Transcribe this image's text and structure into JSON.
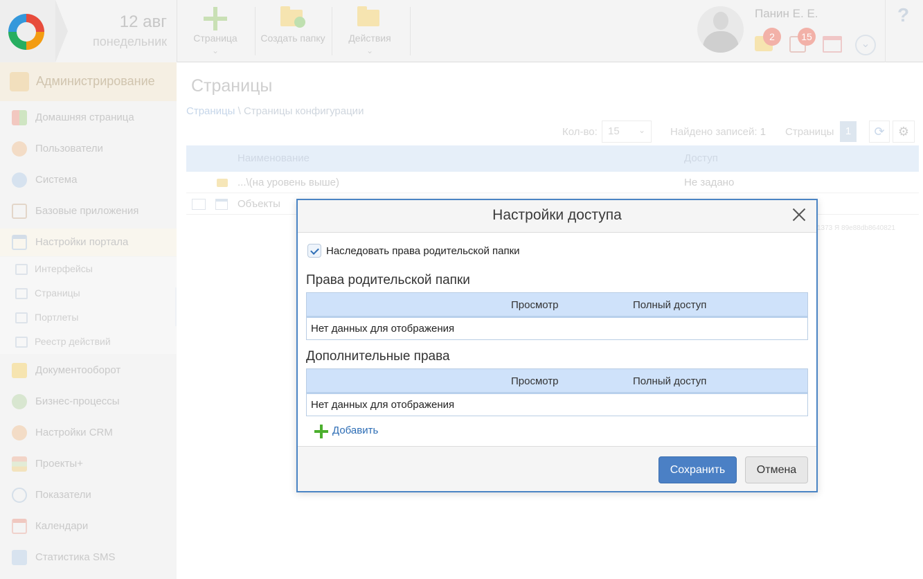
{
  "topbar": {
    "date_day": "12 авг",
    "date_weekday": "понедельник",
    "buttons": [
      {
        "label": "Страница",
        "icon": "plus-icon"
      },
      {
        "label": "Создать папку",
        "icon": "folder-add-icon"
      },
      {
        "label": "Действия",
        "icon": "folders-icon"
      }
    ],
    "user_name": "Панин Е. Е.",
    "badges": {
      "messages": "2",
      "tasks": "15"
    },
    "help": "?"
  },
  "sidebar": {
    "admin_label": "Администрирование",
    "items": [
      {
        "label": "Домашняя страница",
        "icon": "home-icon"
      },
      {
        "label": "Пользователи",
        "icon": "users-icon"
      },
      {
        "label": "Система",
        "icon": "system-icon"
      },
      {
        "label": "Базовые приложения",
        "icon": "apps-icon"
      },
      {
        "label": "Настройки портала",
        "icon": "portal-settings-icon"
      }
    ],
    "subitems": [
      {
        "label": "Интерфейсы"
      },
      {
        "label": "Страницы"
      },
      {
        "label": "Портлеты"
      },
      {
        "label": "Реестр действий"
      }
    ],
    "items2": [
      {
        "label": "Документооборот"
      },
      {
        "label": "Бизнес-процессы"
      },
      {
        "label": "Настройки CRM"
      },
      {
        "label": "Проекты+"
      },
      {
        "label": "Показатели"
      },
      {
        "label": "Календари"
      },
      {
        "label": "Статистика SMS"
      }
    ]
  },
  "main": {
    "title": "Страницы",
    "breadcrumb_link": "Страницы",
    "breadcrumb_rest": " \\ Страницы конфигурации",
    "pager": {
      "count_label": "Кол-во:",
      "count_value": "15",
      "found_label": "Найдено записей:",
      "found_value": "1",
      "pages_label": "Страницы",
      "page": "1"
    },
    "grid": {
      "col_name": "Наименование",
      "col_access": "Доступ",
      "rows": [
        {
          "name": "...\\(на уровень выше)",
          "access": "Не задано"
        },
        {
          "name": "Объекты",
          "access": ""
        }
      ]
    },
    "hash": "1373 Я 89e88db8640821"
  },
  "dialog": {
    "title": "Настройки доступа",
    "inherit_label": "Наследовать права родительской папки",
    "inherit_checked": true,
    "parent_rights_title": "Права родительской папки",
    "extra_rights_title": "Дополнительные права",
    "col_view": "Просмотр",
    "col_full": "Полный доступ",
    "empty_text": "Нет данных для отображения",
    "add_label": "Добавить",
    "save_label": "Сохранить",
    "cancel_label": "Отмена"
  },
  "colors": {
    "accent": "#4b80c5",
    "dialog_border": "#4a84c4",
    "table_header": "#cfe2fa",
    "add_plus": "#4caf2e"
  }
}
